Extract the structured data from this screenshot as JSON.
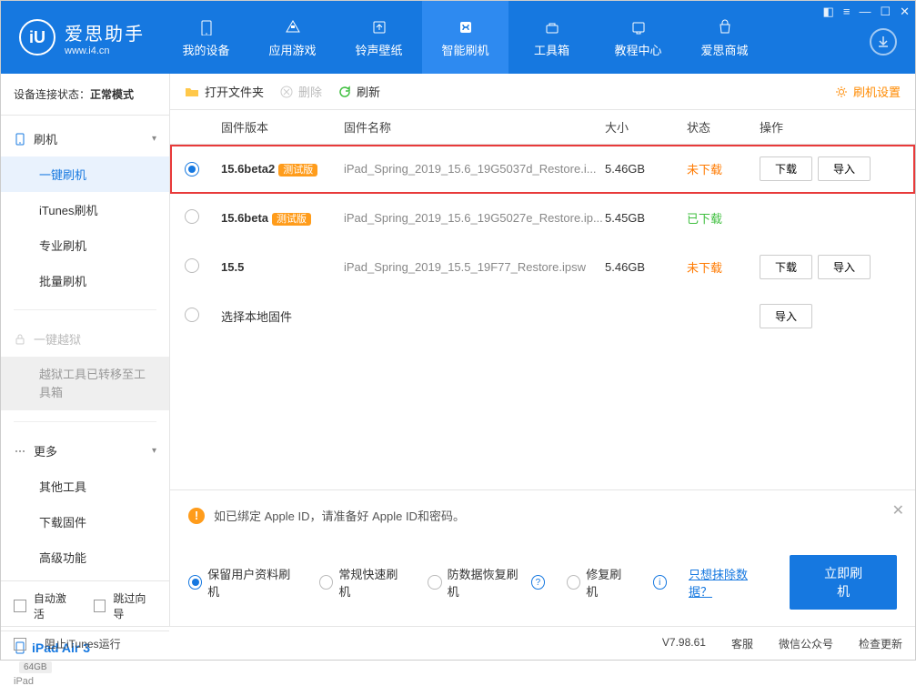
{
  "header": {
    "logo_title": "爱思助手",
    "logo_sub": "www.i4.cn",
    "logo_letters": "iU",
    "nav": [
      "我的设备",
      "应用游戏",
      "铃声壁纸",
      "智能刷机",
      "工具箱",
      "教程中心",
      "爱思商城"
    ],
    "active_nav_index": 3
  },
  "sidebar": {
    "status_label": "设备连接状态：",
    "status_value": "正常模式",
    "section_flash": {
      "title": "刷机",
      "items": [
        "一键刷机",
        "iTunes刷机",
        "专业刷机",
        "批量刷机"
      ],
      "active_index": 0
    },
    "section_jail": {
      "title": "一键越狱",
      "note": "越狱工具已转移至工具箱"
    },
    "section_more": {
      "title": "更多",
      "items": [
        "其他工具",
        "下载固件",
        "高级功能"
      ]
    },
    "auto_activate": "自动激活",
    "skip_guide": "跳过向导",
    "device_name": "iPad Air 3",
    "device_storage": "64GB",
    "device_type": "iPad"
  },
  "toolbar": {
    "open_folder": "打开文件夹",
    "delete": "删除",
    "refresh": "刷新",
    "settings": "刷机设置"
  },
  "table": {
    "headers": {
      "version": "固件版本",
      "name": "固件名称",
      "size": "大小",
      "status": "状态",
      "action": "操作"
    },
    "btn_download": "下载",
    "btn_import": "导入",
    "rows": [
      {
        "selected": true,
        "highlight": true,
        "version": "15.6beta2",
        "badge": "测试版",
        "name": "iPad_Spring_2019_15.6_19G5037d_Restore.i...",
        "size": "5.46GB",
        "status": "未下载",
        "status_class": "status-orange",
        "show_dl": true,
        "show_imp": true
      },
      {
        "selected": false,
        "version": "15.6beta",
        "badge": "测试版",
        "name": "iPad_Spring_2019_15.6_19G5027e_Restore.ip...",
        "size": "5.45GB",
        "status": "已下载",
        "status_class": "status-green",
        "show_dl": false,
        "show_imp": false
      },
      {
        "selected": false,
        "version": "15.5",
        "badge": "",
        "name": "iPad_Spring_2019_15.5_19F77_Restore.ipsw",
        "size": "5.46GB",
        "status": "未下载",
        "status_class": "status-orange",
        "show_dl": true,
        "show_imp": true
      },
      {
        "selected": false,
        "version": "",
        "badge": "",
        "name_override": "选择本地固件",
        "size": "",
        "status": "",
        "status_class": "",
        "show_dl": false,
        "show_imp": true
      }
    ]
  },
  "info": {
    "text": "如已绑定 Apple ID，请准备好 Apple ID和密码。"
  },
  "options": {
    "opts": [
      "保留用户资料刷机",
      "常规快速刷机",
      "防数据恢复刷机",
      "修复刷机"
    ],
    "selected_index": 0,
    "erase_link": "只想抹除数据？",
    "flash_btn": "立即刷机"
  },
  "footer": {
    "block_itunes": "阻止iTunes运行",
    "version": "V7.98.61",
    "links": [
      "客服",
      "微信公众号",
      "检查更新"
    ]
  }
}
